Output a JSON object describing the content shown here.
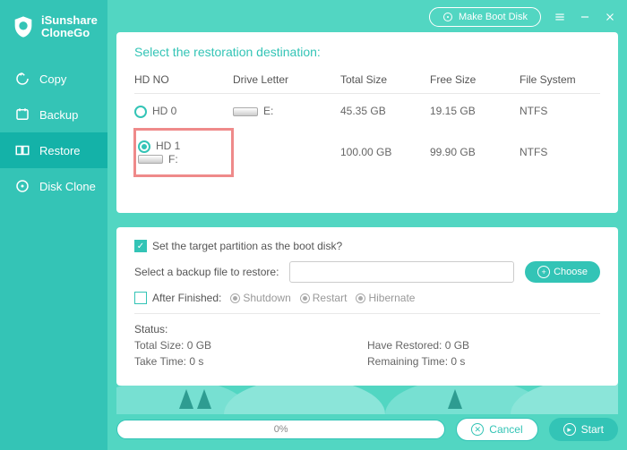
{
  "app": {
    "brand1": "iSunshare",
    "brand2": "CloneGo"
  },
  "titlebar": {
    "boot": "Make Boot Disk"
  },
  "sidebar": {
    "items": [
      {
        "label": "Copy"
      },
      {
        "label": "Backup"
      },
      {
        "label": "Restore"
      },
      {
        "label": "Disk Clone"
      }
    ]
  },
  "dest_panel": {
    "title": "Select the restoration destination:",
    "headers": {
      "hdno": "HD NO",
      "letter": "Drive Letter",
      "total": "Total Size",
      "free": "Free Size",
      "fs": "File System"
    },
    "rows": [
      {
        "hd": "HD 0",
        "letter": "E:",
        "total": "45.35 GB",
        "free": "19.15 GB",
        "fs": "NTFS",
        "checked": false
      },
      {
        "hd": "HD 1",
        "letter": "F:",
        "total": "100.00 GB",
        "free": "99.90 GB",
        "fs": "NTFS",
        "checked": true
      }
    ]
  },
  "options": {
    "boot_question": "Set the target partition as the boot disk?",
    "select_backup_label": "Select a backup file to restore:",
    "choose": "Choose",
    "after_finished": "After Finished:",
    "shutdown": "Shutdown",
    "restart": "Restart",
    "hibernate": "Hibernate",
    "status_label": "Status:",
    "total_size": "Total Size: 0 GB",
    "have_restored": "Have Restored: 0 GB",
    "take_time": "Take Time: 0 s",
    "remaining": "Remaining Time: 0 s"
  },
  "footer": {
    "progress": "0%",
    "cancel": "Cancel",
    "start": "Start"
  }
}
